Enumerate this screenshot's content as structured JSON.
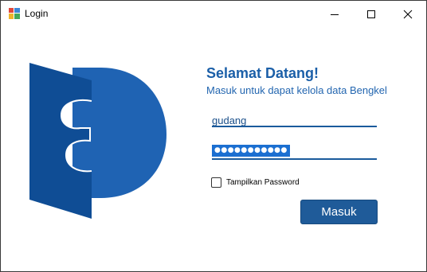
{
  "window": {
    "title": "Login",
    "controls": {
      "minimize_icon": "minimize-icon",
      "maximize_icon": "maximize-icon",
      "close_icon": "close-icon"
    }
  },
  "header": {
    "welcome": "Selamat Datang!",
    "subtitle": "Masuk untuk dapat kelola data Bengkel"
  },
  "form": {
    "username": "gudang",
    "password_mask": "●●●●●●●●●●●",
    "show_password_label": "Tampilkan Password",
    "show_password_checked": false,
    "submit_label": "Masuk"
  },
  "colors": {
    "brand": "#1b5fa8",
    "brand_dark": "#1a5a9c",
    "button": "#1f5b99",
    "selection": "#1b6fd1"
  }
}
